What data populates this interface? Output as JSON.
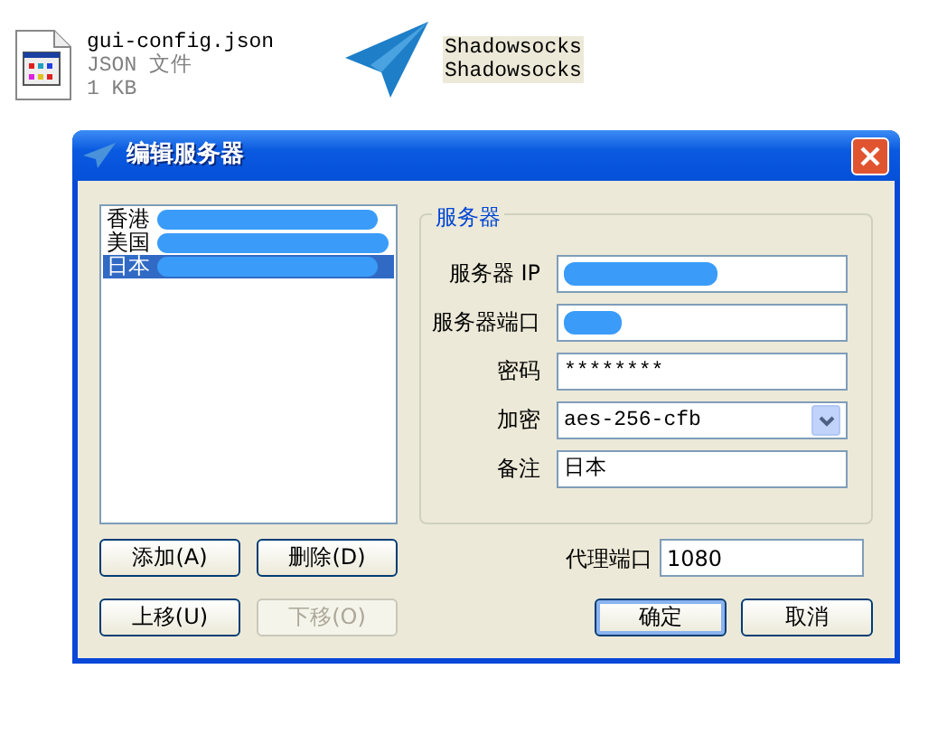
{
  "desktop_items": [
    {
      "kind": "file",
      "name": "gui-config.json",
      "type": "JSON 文件",
      "size": "1 KB"
    },
    {
      "kind": "app",
      "name": "Shadowsocks",
      "subtitle": "Shadowsocks"
    }
  ],
  "window": {
    "title": "编辑服务器"
  },
  "server_list": [
    {
      "name": "香港",
      "redacted": true,
      "selected": false
    },
    {
      "name": "美国",
      "redacted": true,
      "selected": false
    },
    {
      "name": "日本",
      "redacted": true,
      "selected": true
    }
  ],
  "list_buttons": [
    {
      "label": "添加(A)",
      "disabled": false
    },
    {
      "label": "删除(D)",
      "disabled": false
    },
    {
      "label": "上移(U)",
      "disabled": false
    },
    {
      "label": "下移(O)",
      "disabled": true
    }
  ],
  "server_group": {
    "title": "服务器",
    "fields": [
      {
        "label": "服务器 IP",
        "kind": "text",
        "redacted": true
      },
      {
        "label": "服务器端口",
        "kind": "text",
        "redacted": true
      },
      {
        "label": "密码",
        "kind": "text",
        "value": "********"
      },
      {
        "label": "加密",
        "kind": "select",
        "value": "aes-256-cfb"
      },
      {
        "label": "备注",
        "kind": "text",
        "value": "日本"
      }
    ]
  },
  "proxy_port": {
    "label": "代理端口",
    "value": "1080"
  },
  "dialog_buttons": [
    {
      "label": "确定",
      "default": true
    },
    {
      "label": "取消",
      "default": false
    }
  ]
}
